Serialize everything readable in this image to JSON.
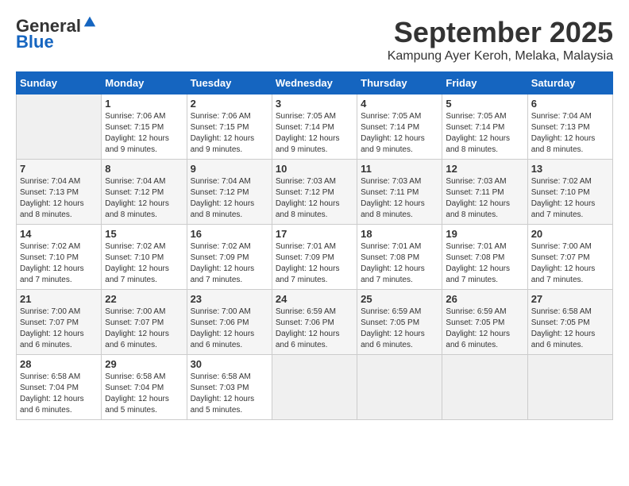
{
  "logo": {
    "general": "General",
    "blue": "Blue"
  },
  "title": "September 2025",
  "subtitle": "Kampung Ayer Keroh, Melaka, Malaysia",
  "days_of_week": [
    "Sunday",
    "Monday",
    "Tuesday",
    "Wednesday",
    "Thursday",
    "Friday",
    "Saturday"
  ],
  "weeks": [
    [
      {
        "day": "",
        "sunrise": "",
        "sunset": "",
        "daylight": ""
      },
      {
        "day": "1",
        "sunrise": "Sunrise: 7:06 AM",
        "sunset": "Sunset: 7:15 PM",
        "daylight": "Daylight: 12 hours and 9 minutes."
      },
      {
        "day": "2",
        "sunrise": "Sunrise: 7:06 AM",
        "sunset": "Sunset: 7:15 PM",
        "daylight": "Daylight: 12 hours and 9 minutes."
      },
      {
        "day": "3",
        "sunrise": "Sunrise: 7:05 AM",
        "sunset": "Sunset: 7:14 PM",
        "daylight": "Daylight: 12 hours and 9 minutes."
      },
      {
        "day": "4",
        "sunrise": "Sunrise: 7:05 AM",
        "sunset": "Sunset: 7:14 PM",
        "daylight": "Daylight: 12 hours and 9 minutes."
      },
      {
        "day": "5",
        "sunrise": "Sunrise: 7:05 AM",
        "sunset": "Sunset: 7:14 PM",
        "daylight": "Daylight: 12 hours and 8 minutes."
      },
      {
        "day": "6",
        "sunrise": "Sunrise: 7:04 AM",
        "sunset": "Sunset: 7:13 PM",
        "daylight": "Daylight: 12 hours and 8 minutes."
      }
    ],
    [
      {
        "day": "7",
        "sunrise": "Sunrise: 7:04 AM",
        "sunset": "Sunset: 7:13 PM",
        "daylight": "Daylight: 12 hours and 8 minutes."
      },
      {
        "day": "8",
        "sunrise": "Sunrise: 7:04 AM",
        "sunset": "Sunset: 7:12 PM",
        "daylight": "Daylight: 12 hours and 8 minutes."
      },
      {
        "day": "9",
        "sunrise": "Sunrise: 7:04 AM",
        "sunset": "Sunset: 7:12 PM",
        "daylight": "Daylight: 12 hours and 8 minutes."
      },
      {
        "day": "10",
        "sunrise": "Sunrise: 7:03 AM",
        "sunset": "Sunset: 7:12 PM",
        "daylight": "Daylight: 12 hours and 8 minutes."
      },
      {
        "day": "11",
        "sunrise": "Sunrise: 7:03 AM",
        "sunset": "Sunset: 7:11 PM",
        "daylight": "Daylight: 12 hours and 8 minutes."
      },
      {
        "day": "12",
        "sunrise": "Sunrise: 7:03 AM",
        "sunset": "Sunset: 7:11 PM",
        "daylight": "Daylight: 12 hours and 8 minutes."
      },
      {
        "day": "13",
        "sunrise": "Sunrise: 7:02 AM",
        "sunset": "Sunset: 7:10 PM",
        "daylight": "Daylight: 12 hours and 7 minutes."
      }
    ],
    [
      {
        "day": "14",
        "sunrise": "Sunrise: 7:02 AM",
        "sunset": "Sunset: 7:10 PM",
        "daylight": "Daylight: 12 hours and 7 minutes."
      },
      {
        "day": "15",
        "sunrise": "Sunrise: 7:02 AM",
        "sunset": "Sunset: 7:10 PM",
        "daylight": "Daylight: 12 hours and 7 minutes."
      },
      {
        "day": "16",
        "sunrise": "Sunrise: 7:02 AM",
        "sunset": "Sunset: 7:09 PM",
        "daylight": "Daylight: 12 hours and 7 minutes."
      },
      {
        "day": "17",
        "sunrise": "Sunrise: 7:01 AM",
        "sunset": "Sunset: 7:09 PM",
        "daylight": "Daylight: 12 hours and 7 minutes."
      },
      {
        "day": "18",
        "sunrise": "Sunrise: 7:01 AM",
        "sunset": "Sunset: 7:08 PM",
        "daylight": "Daylight: 12 hours and 7 minutes."
      },
      {
        "day": "19",
        "sunrise": "Sunrise: 7:01 AM",
        "sunset": "Sunset: 7:08 PM",
        "daylight": "Daylight: 12 hours and 7 minutes."
      },
      {
        "day": "20",
        "sunrise": "Sunrise: 7:00 AM",
        "sunset": "Sunset: 7:07 PM",
        "daylight": "Daylight: 12 hours and 7 minutes."
      }
    ],
    [
      {
        "day": "21",
        "sunrise": "Sunrise: 7:00 AM",
        "sunset": "Sunset: 7:07 PM",
        "daylight": "Daylight: 12 hours and 6 minutes."
      },
      {
        "day": "22",
        "sunrise": "Sunrise: 7:00 AM",
        "sunset": "Sunset: 7:07 PM",
        "daylight": "Daylight: 12 hours and 6 minutes."
      },
      {
        "day": "23",
        "sunrise": "Sunrise: 7:00 AM",
        "sunset": "Sunset: 7:06 PM",
        "daylight": "Daylight: 12 hours and 6 minutes."
      },
      {
        "day": "24",
        "sunrise": "Sunrise: 6:59 AM",
        "sunset": "Sunset: 7:06 PM",
        "daylight": "Daylight: 12 hours and 6 minutes."
      },
      {
        "day": "25",
        "sunrise": "Sunrise: 6:59 AM",
        "sunset": "Sunset: 7:05 PM",
        "daylight": "Daylight: 12 hours and 6 minutes."
      },
      {
        "day": "26",
        "sunrise": "Sunrise: 6:59 AM",
        "sunset": "Sunset: 7:05 PM",
        "daylight": "Daylight: 12 hours and 6 minutes."
      },
      {
        "day": "27",
        "sunrise": "Sunrise: 6:58 AM",
        "sunset": "Sunset: 7:05 PM",
        "daylight": "Daylight: 12 hours and 6 minutes."
      }
    ],
    [
      {
        "day": "28",
        "sunrise": "Sunrise: 6:58 AM",
        "sunset": "Sunset: 7:04 PM",
        "daylight": "Daylight: 12 hours and 6 minutes."
      },
      {
        "day": "29",
        "sunrise": "Sunrise: 6:58 AM",
        "sunset": "Sunset: 7:04 PM",
        "daylight": "Daylight: 12 hours and 5 minutes."
      },
      {
        "day": "30",
        "sunrise": "Sunrise: 6:58 AM",
        "sunset": "Sunset: 7:03 PM",
        "daylight": "Daylight: 12 hours and 5 minutes."
      },
      {
        "day": "",
        "sunrise": "",
        "sunset": "",
        "daylight": ""
      },
      {
        "day": "",
        "sunrise": "",
        "sunset": "",
        "daylight": ""
      },
      {
        "day": "",
        "sunrise": "",
        "sunset": "",
        "daylight": ""
      },
      {
        "day": "",
        "sunrise": "",
        "sunset": "",
        "daylight": ""
      }
    ]
  ]
}
